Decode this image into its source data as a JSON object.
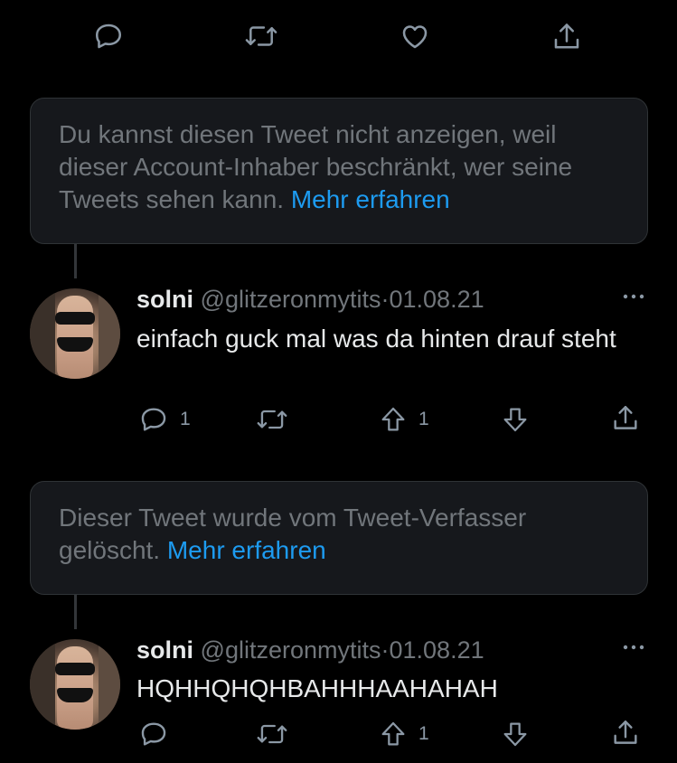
{
  "notice_protected": {
    "text": "Du kannst diesen Tweet nicht anzeigen, weil dieser Account-Inhaber beschränkt, wer seine Tweets sehen kann.",
    "link": "Mehr erfahren"
  },
  "notice_deleted": {
    "text": "Dieser Tweet wurde vom Tweet-Verfasser gelöscht.",
    "link": "Mehr erfahren"
  },
  "tweets": [
    {
      "name": "solni",
      "handle": "@glitzeronmytits",
      "separator": "·",
      "date": "01.08.21",
      "text": "einfach guck mal was da hinten drauf steht",
      "reply_count": "1",
      "upvote_count": "1"
    },
    {
      "name": "solni",
      "handle": "@glitzeronmytits",
      "separator": "·",
      "date": "01.08.21",
      "text": "HQHHQHQHBAHHHAAHAHAH",
      "reply_count": "",
      "upvote_count": "1"
    }
  ],
  "colors": {
    "background": "#000000",
    "card": "#16181c",
    "link": "#1d9bf0",
    "muted": "#71767b",
    "icon": "#8b98a5"
  },
  "icons": [
    "reply-icon",
    "retweet-icon",
    "like-icon",
    "share-icon",
    "upvote-icon",
    "downvote-icon",
    "more-icon"
  ]
}
